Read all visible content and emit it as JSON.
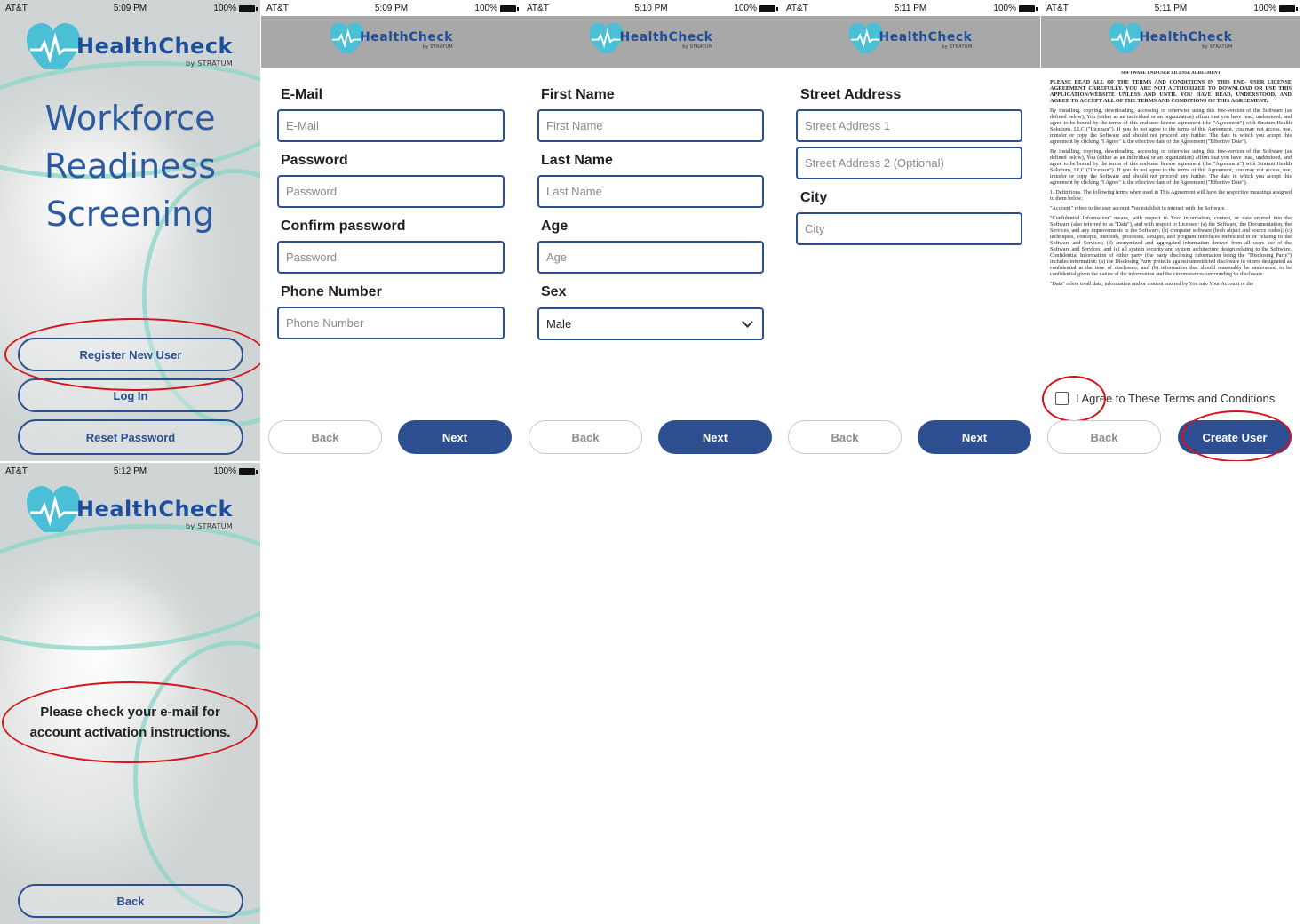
{
  "status": {
    "carrier": "AT&T",
    "battery": "100%",
    "times": [
      "5:09 PM",
      "5:09 PM",
      "5:10 PM",
      "5:11 PM",
      "5:11 PM",
      "5:12 PM"
    ]
  },
  "brand": {
    "name": "HealthCheck",
    "by": "by STRATUM",
    "heart_color": "#4bbfd6",
    "text_color": "#1d4e9b"
  },
  "welcome": {
    "title_lines": [
      "Workforce",
      "Readiness",
      "Screening"
    ],
    "register_label": "Register New User",
    "login_label": "Log In",
    "reset_label": "Reset Password"
  },
  "step1": {
    "email_label": "E-Mail",
    "email_placeholder": "E-Mail",
    "password_label": "Password",
    "password_placeholder": "Password",
    "confirm_label": "Confirm password",
    "confirm_placeholder": "Password",
    "phone_label": "Phone Number",
    "phone_placeholder": "Phone Number"
  },
  "step2": {
    "first_label": "First Name",
    "first_placeholder": "First Name",
    "last_label": "Last Name",
    "last_placeholder": "Last Name",
    "age_label": "Age",
    "age_placeholder": "Age",
    "sex_label": "Sex",
    "sex_value": "Male"
  },
  "step3": {
    "street_label": "Street Address",
    "street1_placeholder": "Street Address 1",
    "street2_placeholder": "Street Address 2 (Optional)",
    "city_label": "City",
    "city_placeholder": "City"
  },
  "step4": {
    "heading": "SOFTWARE END-USER LICENSE AGREEMENT",
    "paragraphs": [
      "PLEASE READ ALL OF THE TERMS AND CONDITIONS IN THIS END- USER LICENSE AGREEMENT CAREFULLY. YOU ARE NOT AUTHORIZED TO DOWNLOAD OR USE THIS APPLICATION/WEBSITE UNLESS AND UNTIL YOU HAVE READ, UNDERSTOOD, AND AGREE TO ACCEPT ALL OF THE TERMS AND CONDITIONS OF THIS AGREEMENT.",
      "By installing, copying, downloading, accessing or otherwise using this free-version of the Software (as defined below), You (either as an individual or an organization) affirm that you have read, understood, and agree to be bound by the terms of this end-user license agreement (the \"Agreement\") with Stratum Health Solutions, LLC (\"Licensor\"). If you do not agree to the terms of this Agreement, you may not access, use, transfer or copy the Software and should not proceed any further. The date in which you accept this agreement by clicking \"I Agree\" is the effective date of the Agreement (\"Effective Date\").",
      "By installing, copying, downloading, accessing or otherwise using this free-version of the Software (as defined below), You (either as an individual or an organization) affirm that you have read, understood, and agree to be bound by the terms of this end-user license agreement (the \"Agreement\") with Stratum Health Solutions, LLC (\"Licensor\"). If you do not agree to the terms of this Agreement, you may not access, use, transfer or copy the Software and should not proceed any further. The date in which you accept this agreement by clicking \"I Agree\" is the effective date of the Agreement (\"Effective Date\").",
      "1. Definitions. The following terms when used in This Agreement will have the respective meanings assigned to them below:",
      "\"Account\" refers to the user account You establish to interact with the Software.",
      "\"Confidential Information\" means, with respect to You: information, content, or data entered into the Software (also referred to as \"Data\"), and with respect to Licensor: (a) the Software, the Documentation, the Services, and any improvements to the Software; (b) computer software (both object and source codes); (c) techniques, concepts, methods, processes, designs, and program interfaces embodied in or relating to the Software and Services; (d) anonymized and aggregated information derived from all users use of the Software and Services; and (e) all system security and system architecture design relating to the Software. Confidential Information of either party (the party disclosing information being the \"Disclosing Party\") includes information: (a) the Disclosing Party protects against unrestricted disclosure to others designated as confidential at the time of disclosure; and (b) information that should reasonably be understood to be confidential given the nature of the information and the circumstances surrounding its disclosure.",
      "\"Data\" refers to all data, information and/or content entered by You into Your Account or the"
    ],
    "agree_label": "I Agree to These Terms and Conditions",
    "create_label": "Create User"
  },
  "confirm": {
    "message_lines": [
      "Please check your e-mail for",
      "account activation instructions."
    ],
    "back_label": "Back"
  },
  "nav": {
    "back_label": "Back",
    "next_label": "Next"
  }
}
